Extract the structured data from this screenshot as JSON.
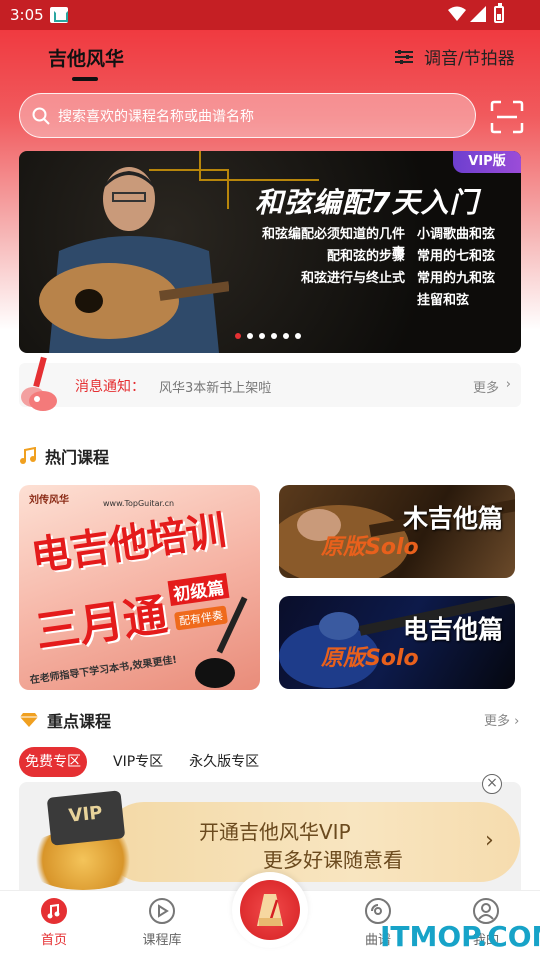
{
  "status_bar": {
    "time": "3:05"
  },
  "header": {
    "title": "吉他风华",
    "tuner_label": "调音/节拍器"
  },
  "search": {
    "placeholder": "搜索喜欢的课程名称或曲谱名称"
  },
  "banner": {
    "tag": "VIP版",
    "title": "和弦编配7天入门",
    "rows": [
      {
        "left": "和弦编配必须知道的几件事",
        "right": "小调歌曲和弦"
      },
      {
        "left": "配和弦的步骤",
        "right": "常用的七和弦"
      },
      {
        "left": "和弦进行与终止式",
        "right": "常用的九和弦"
      },
      {
        "left": "",
        "right": "挂留和弦"
      }
    ]
  },
  "notice": {
    "label": "消息通知：",
    "message": "风华3本新书上架啦",
    "more": "更多"
  },
  "hot_courses": {
    "title": "热门课程",
    "big_card": {
      "logo": "刘传风华",
      "url": "www.TopGuitar.cn",
      "line1": "电吉他培训",
      "line2": "三月通",
      "level": "初级篇",
      "badge": "配有伴奏",
      "footer": "在老师指导下学习本书,效果更佳!"
    },
    "acoustic": {
      "name": "木吉他篇",
      "solo": "原版Solo"
    },
    "electric": {
      "name": "电吉他篇",
      "solo": "原版Solo"
    }
  },
  "key_courses": {
    "title": "重点课程",
    "more": "更多",
    "tabs": [
      "免费专区",
      "VIP专区",
      "永久版专区"
    ]
  },
  "promo": {
    "card": "VIP",
    "line1": "开通吉他风华VIP",
    "line2": "更多好课随意看"
  },
  "bottom_nav": [
    "首页",
    "课程库",
    "曲谱",
    "我的"
  ],
  "watermark": "ITMOP.COM",
  "colors": {
    "accent": "#e53033",
    "brand_bg": "#ef2f36"
  }
}
